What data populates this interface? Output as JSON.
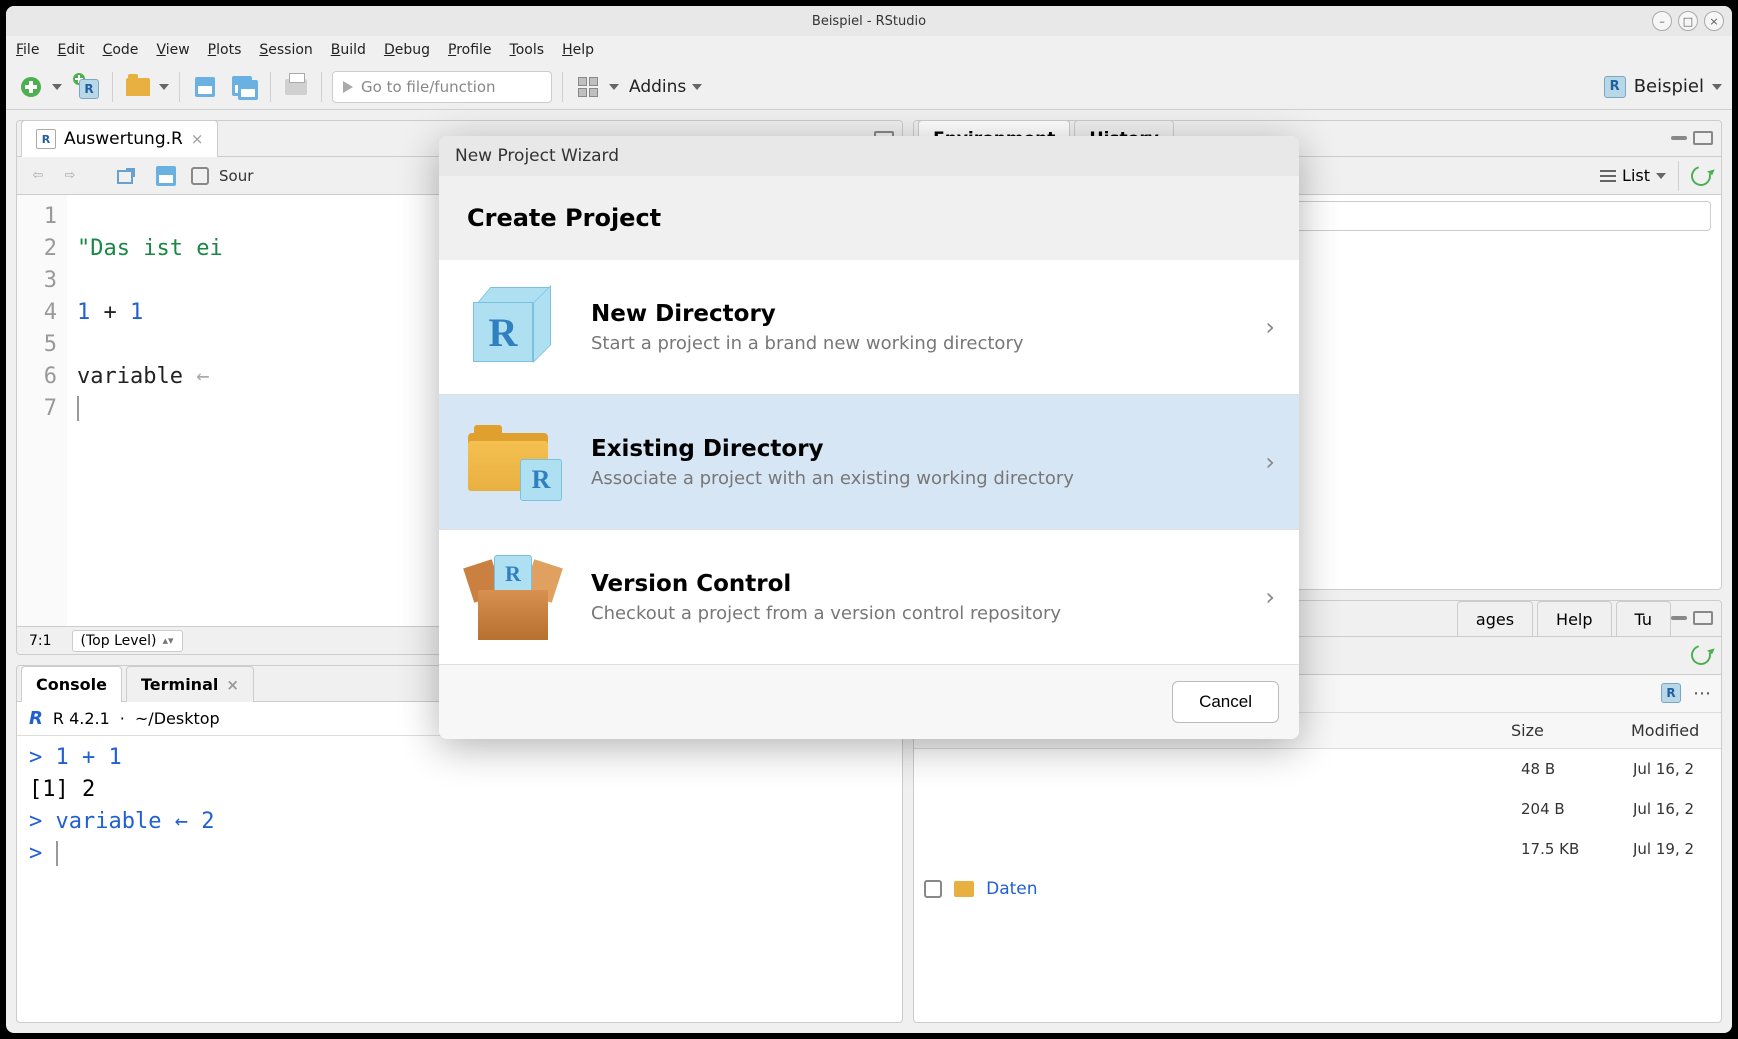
{
  "titlebar": {
    "title": "Beispiel - RStudio"
  },
  "menubar": [
    "File",
    "Edit",
    "Code",
    "View",
    "Plots",
    "Session",
    "Build",
    "Debug",
    "Profile",
    "Tools",
    "Help"
  ],
  "toolbar": {
    "goto_placeholder": "Go to file/function",
    "addins_label": "Addins",
    "project_name": "Beispiel"
  },
  "source_pane": {
    "tab_filename": "Auswertung.R",
    "source_on_save_label": "Sour",
    "lines": [
      "1",
      "2",
      "3",
      "4",
      "5",
      "6",
      "7"
    ],
    "code": {
      "l2_string": "\"Das ist ei",
      "l4_expr_a": "1",
      "l4_op": " + ",
      "l4_expr_b": "1",
      "l6_ident": "variable",
      "l6_arrow": " ← "
    },
    "status_pos": "7:1",
    "status_scope": "(Top Level)"
  },
  "console_pane": {
    "tabs": [
      "Console",
      "Terminal"
    ],
    "version": "R 4.2.1",
    "path": "~/Desktop",
    "lines": {
      "l1_prompt": "> ",
      "l1_a": "1",
      "l1_op": " + ",
      "l1_b": "1",
      "l2": "[1] 2",
      "l3_prompt": "> ",
      "l3_ident": "variable",
      "l3_arrow": " ← ",
      "l3_val": "2",
      "l4_prompt": "> "
    }
  },
  "env_pane": {
    "tabs": [
      "Environment",
      "History"
    ],
    "list_label": "List"
  },
  "files_pane": {
    "tabs_partial": [
      "ages",
      "Help",
      "Tu"
    ],
    "col_size": "Size",
    "col_modified": "Modified",
    "rows": [
      {
        "name": "",
        "size": "48 B",
        "modified": "Jul 16, 2"
      },
      {
        "name": "",
        "size": "204 B",
        "modified": "Jul 16, 2"
      },
      {
        "name": "",
        "size": "17.5 KB",
        "modified": "Jul 19, 2"
      }
    ],
    "folder_row_name": "Daten"
  },
  "dialog": {
    "head": "New Project Wizard",
    "title": "Create Project",
    "options": [
      {
        "hd": "New Directory",
        "sub": "Start a project in a brand new working directory"
      },
      {
        "hd": "Existing Directory",
        "sub": "Associate a project with an existing working directory"
      },
      {
        "hd": "Version Control",
        "sub": "Checkout a project from a version control repository"
      }
    ],
    "cancel": "Cancel"
  }
}
